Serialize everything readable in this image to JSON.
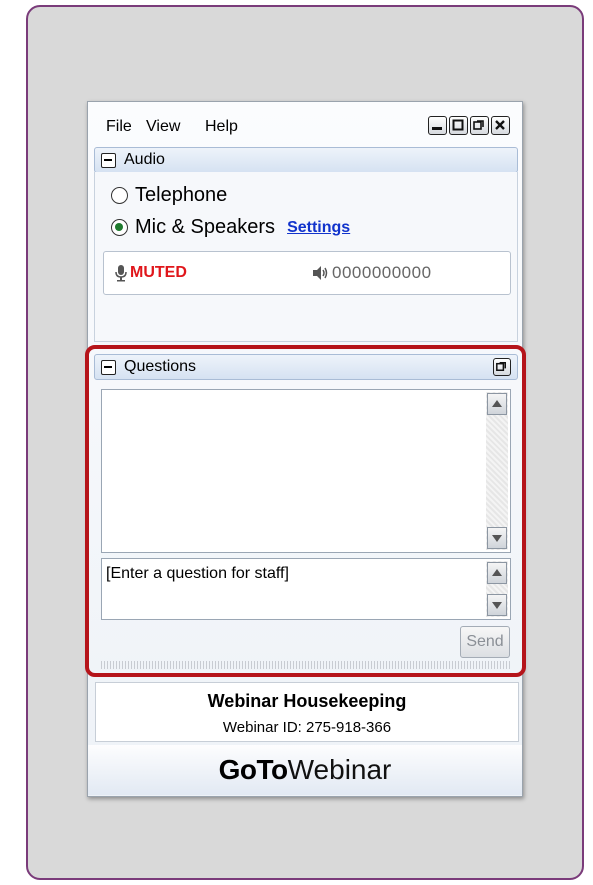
{
  "menu": {
    "file": "File",
    "view": "View",
    "help": "Help"
  },
  "window_controls": [
    "minimize-icon",
    "maximize-icon",
    "restore-icon",
    "close-icon"
  ],
  "audio": {
    "title": "Audio",
    "options": [
      {
        "label": "Telephone",
        "selected": false
      },
      {
        "label": "Mic & Speakers",
        "selected": true
      }
    ],
    "settings_link": "Settings",
    "mic_status": "MUTED",
    "speaker_level": "0000000000"
  },
  "questions": {
    "title": "Questions",
    "placeholder": "[Enter a question for staff]",
    "send_label": "Send"
  },
  "info": {
    "title": "Webinar Housekeeping",
    "webinar_id": "Webinar ID: 275-918-366"
  },
  "brand": {
    "bold": "GoTo",
    "light": "Webinar"
  },
  "colors": {
    "highlight": "#b5141a",
    "muted": "#e0161b",
    "link": "#1133cc",
    "frame_border": "#7a3b7a"
  }
}
